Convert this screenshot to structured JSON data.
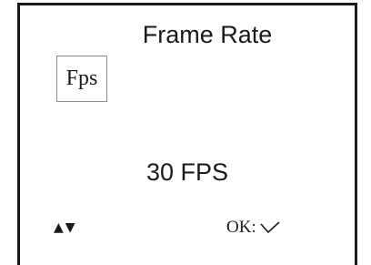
{
  "screen": {
    "title": "Frame Rate",
    "badge_label": "Fps",
    "value": "30 FPS",
    "nav_hint": {
      "up_symbol": "▲",
      "down_symbol": "▼"
    },
    "ok_hint": {
      "label": "OK:",
      "icon": "checkmark-icon"
    }
  }
}
